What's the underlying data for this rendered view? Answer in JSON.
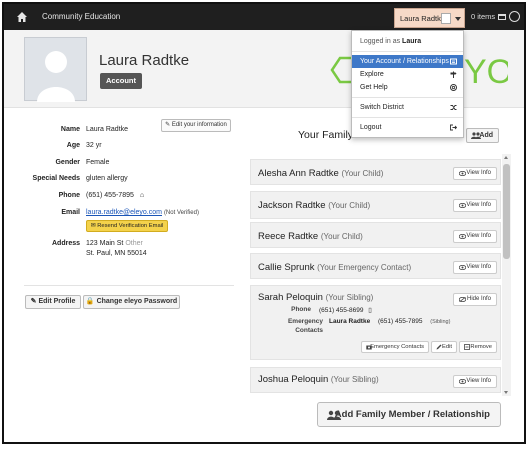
{
  "nav": {
    "brand": "Community Education",
    "user_menu_label": "Laura Radtke",
    "cart_label": "0 items"
  },
  "header": {
    "profile_name": "Laura Radtke",
    "account_badge": "Account"
  },
  "dropdown": {
    "logged_in_prefix": "Logged in as",
    "logged_in_user": "Laura",
    "items": [
      {
        "label": "Your Account / Relationships",
        "icon": "id-card-icon"
      },
      {
        "label": "Explore",
        "icon": "signpost-icon"
      },
      {
        "label": "Get Help",
        "icon": "lifebuoy-icon"
      },
      {
        "label": "Switch District",
        "icon": "shuffle-icon"
      },
      {
        "label": "Logout",
        "icon": "sign-out-icon"
      }
    ]
  },
  "info": {
    "edit_button": "Edit your information",
    "name_label": "Name",
    "name": "Laura Radtke",
    "age_label": "Age",
    "age": "32 yr",
    "gender_label": "Gender",
    "gender": "Female",
    "special_label": "Special Needs",
    "special": "gluten allergy",
    "phone_label": "Phone",
    "phone": "(651) 455-7895",
    "email_label": "Email",
    "email": "laura.radtke@eleyo.com",
    "email_status": "(Not Verified)",
    "resend_button": "Resend Verification Email",
    "address_label": "Address",
    "address_line1": "123 Main St",
    "address_tag": "Other",
    "address_line2": "St. Paul, MN 55014",
    "edit_profile_button": "Edit Profile",
    "change_password_button": "Change eleyo Password"
  },
  "family": {
    "title": "Your Family",
    "add_button": "Add",
    "view_label": "View Info",
    "hide_label": "Hide Info",
    "members": [
      {
        "name": "Alesha Ann Radtke",
        "relation": "(Your Child)"
      },
      {
        "name": "Jackson Radtke",
        "relation": "(Your Child)"
      },
      {
        "name": "Reece Radtke",
        "relation": "(Your Child)"
      },
      {
        "name": "Callie Sprunk",
        "relation": "(Your Emergency Contact)"
      },
      {
        "name": "Sarah Peloquin",
        "relation": "(Your Sibling)"
      },
      {
        "name": "Joshua Peloquin",
        "relation": "(Your Sibling)"
      }
    ],
    "expanded": {
      "phone_label": "Phone",
      "phone": "(651) 455-8699",
      "emergency_label_1": "Emergency",
      "emergency_label_2": "Contacts",
      "emergency_name": "Laura Radtke",
      "emergency_phone": "(651) 455-7895",
      "emergency_rel": "(Sibling)",
      "btn_emergency": "Emergency Contacts",
      "btn_edit": "Edit",
      "btn_remove": "Remove"
    },
    "add_member_button": "Add Family Member / Relationship"
  },
  "colors": {
    "nav_bg": "#1f1f1f",
    "user_menu_bg": "#f6d9c7",
    "accent_blue": "#3e78c8",
    "logo_green": "#7ac943",
    "resend_yellow": "#f4d24b"
  }
}
